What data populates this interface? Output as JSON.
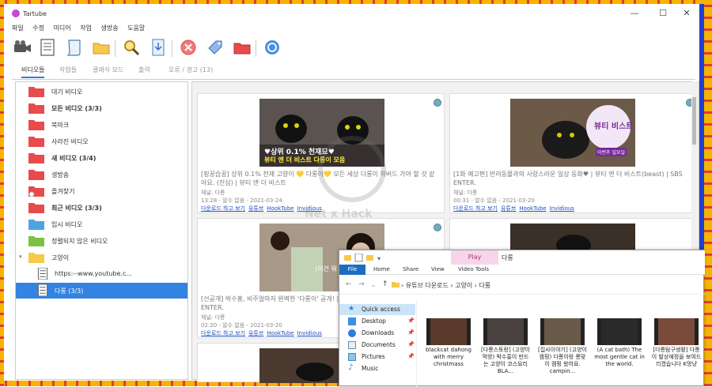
{
  "window": {
    "title": "Tartube",
    "minimize": "—",
    "maximize": "☐",
    "close": "✕"
  },
  "menu": [
    "파일",
    "수정",
    "미디어",
    "작업",
    "생방송",
    "도움말"
  ],
  "tabs": [
    {
      "label": "비디오들",
      "active": true
    },
    {
      "label": "작업들",
      "active": false
    },
    {
      "label": "클래식 모드",
      "active": false
    },
    {
      "label": "출력",
      "active": false
    },
    {
      "label": "오류 / 경고 (13)",
      "active": false
    }
  ],
  "sidebar": [
    {
      "label": "대기 비디오",
      "color": "#e84b4b",
      "bold": false
    },
    {
      "label": "모든 비디오 (3/3)",
      "color": "#e84b4b",
      "bold": true
    },
    {
      "label": "북마크",
      "color": "#e84b4b",
      "bold": false
    },
    {
      "label": "사라진 비디오",
      "color": "#e84b4b",
      "bold": false
    },
    {
      "label": "새 비디오 (3/4)",
      "color": "#e84b4b",
      "bold": true
    },
    {
      "label": "생방송",
      "color": "#e84b4b",
      "bold": false
    },
    {
      "label": "즐겨찾기",
      "color": "#e84b4b",
      "bold": false
    },
    {
      "label": "최근 비디오 (3/3)",
      "color": "#e84b4b",
      "bold": true
    },
    {
      "label": "임시 비디오",
      "color": "#4fa3e0",
      "bold": false
    },
    {
      "label": "정렬되지 않은 비디오",
      "color": "#7cc242",
      "bold": false
    },
    {
      "label": "고양이",
      "color": "#f7c948",
      "bold": false
    },
    {
      "label": "https:--www.youtube.c...",
      "color": "doc",
      "bold": false
    },
    {
      "label": "다롱 (3/3)",
      "color": "doc",
      "bold": false,
      "selected": true
    }
  ],
  "cards": [
    {
      "title": "[핑꿍습꿍] 상위 0.1% 천재 고양이 💛 다롱이💛 모든 세상 다롱이 하버드 가야 할 것 같아요. (진심) | 뷰티 앤 더 비스트",
      "meta": "채널: 다롱",
      "date": "13:28 - 알수 없음 - 2021-03-24",
      "links": [
        "다운로드 하고 보기",
        "유튜브",
        "HookTube",
        "Invidious"
      ],
      "thumb_text": "♥상위 0.1% 천재묘♥",
      "thumb_text2": "뷰티 앤 더 비스트 다롱이 모음"
    },
    {
      "title": "[1화 예고편] 반려동물과의 사랑스러운 일상 동화♥ | 뷰티 앤 더 비스트(beast) | SBS ENTER.",
      "meta": "채널: 다롱",
      "date": "00:31 - 알수 없음 - 2021-03-20",
      "links": [
        "다운로드 하고 보기",
        "유튜브",
        "HookTube",
        "Invidious"
      ],
      "thumb_text": "뷰티 비스트",
      "thumb_text2": "이번주 일요일"
    },
    {
      "title": "[선공개] 박수홍, 비주얼마저 완벽한 '다롱이' 공개! | 뷰티 앤 더 비스트(beast) | SBS ENTER.",
      "meta": "채널: 다롱",
      "date": "02:20 - 알수 없음 - 2021-03-20",
      "links": [
        "다운로드 하고 보기",
        "유튜브",
        "HookTube",
        "Invidious"
      ],
      "thumb_text": "(이건 뭐 송...",
      "thumb_text2": ""
    }
  ],
  "explorer": {
    "play_tab": "Play",
    "title": "다롱",
    "ribbon": [
      "File",
      "Home",
      "Share",
      "View",
      "Video Tools"
    ],
    "breadcrumb": [
      "유튜브 다운로드",
      "고양이",
      "다롱"
    ],
    "nav_items": [
      {
        "label": "Quick access",
        "pin": false
      },
      {
        "label": "Desktop",
        "pin": true
      },
      {
        "label": "Downloads",
        "pin": true
      },
      {
        "label": "Documents",
        "pin": true
      },
      {
        "label": "Pictures",
        "pin": true
      },
      {
        "label": "Music",
        "pin": false
      }
    ],
    "files": [
      "blackcat dahong with merry christmass",
      "[다롱스토랑] (고양이먹방) 박수홍이 만드는 고양이 코스요리 BLA...",
      "[집사이야기] (고양이 캠핑) 다롱이랑 롱맞이 캠핑 왔어요. campin...",
      "(A cat bath) The most gentle cat in the world.",
      "[다롱탐구생활] 다롱이 발상에정을 보여드리겠습니다 K멍냥"
    ]
  },
  "watermark": "Net x Hack"
}
